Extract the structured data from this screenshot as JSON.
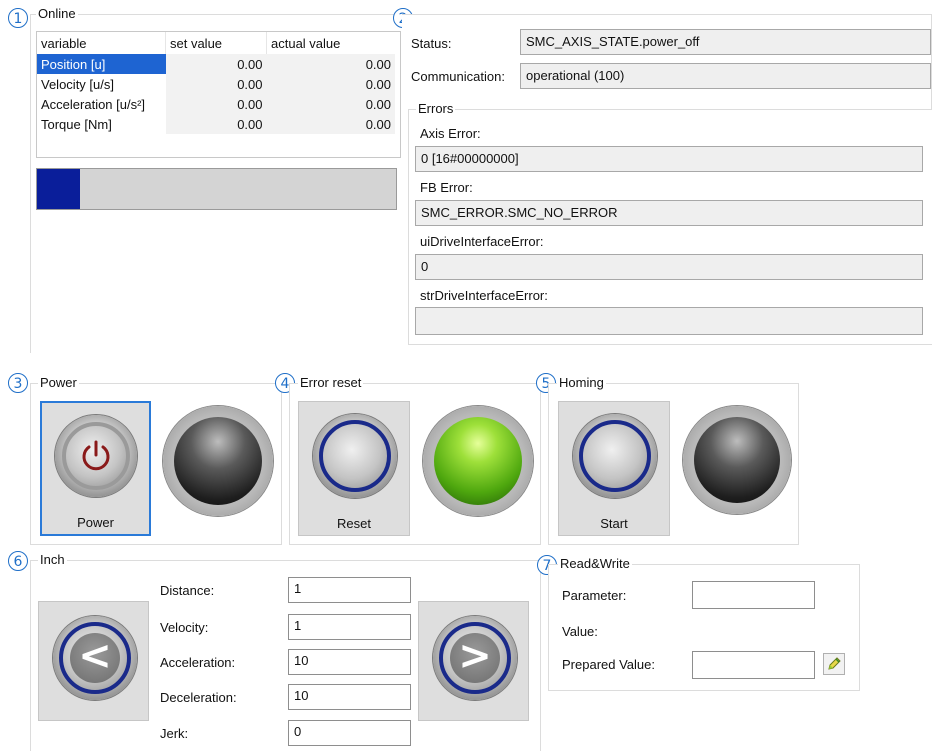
{
  "sections": {
    "online": {
      "num": "1",
      "title": "Online"
    },
    "status": {
      "num": "2"
    },
    "power": {
      "num": "3",
      "title": "Power",
      "button_label": "Power"
    },
    "error_reset": {
      "num": "4",
      "title": "Error reset",
      "button_label": "Reset"
    },
    "homing": {
      "num": "5",
      "title": "Homing",
      "button_label": "Start"
    },
    "inch": {
      "num": "6",
      "title": "Inch"
    },
    "readwrite": {
      "num": "7",
      "title": "Read&Write"
    }
  },
  "online_table": {
    "headers": [
      "variable",
      "set value",
      "actual value"
    ],
    "rows": [
      {
        "variable": "Position [u]",
        "set": "0.00",
        "actual": "0.00"
      },
      {
        "variable": "Velocity [u/s]",
        "set": "0.00",
        "actual": "0.00"
      },
      {
        "variable": "Acceleration [u/s²]",
        "set": "0.00",
        "actual": "0.00"
      },
      {
        "variable": "Torque [Nm]",
        "set": "0.00",
        "actual": "0.00"
      }
    ],
    "selected_row": 0,
    "progress_fraction": 0.12
  },
  "status": {
    "status_label": "Status:",
    "status_value": "SMC_AXIS_STATE.power_off",
    "comm_label": "Communication:",
    "comm_value": "operational (100)",
    "errors_title": "Errors",
    "axis_error_label": "Axis Error:",
    "axis_error_value": "0 [16#00000000]",
    "fb_error_label": "FB Error:",
    "fb_error_value": "SMC_ERROR.SMC_NO_ERROR",
    "ui_drive_label": "uiDriveInterfaceError:",
    "ui_drive_value": "0",
    "str_drive_label": "strDriveInterfaceError:",
    "str_drive_value": ""
  },
  "lamps": {
    "power": "off",
    "error_reset": "green",
    "homing": "off"
  },
  "inch": {
    "distance_label": "Distance:",
    "distance_value": "1",
    "velocity_label": "Velocity:",
    "velocity_value": "1",
    "acceleration_label": "Acceleration:",
    "acceleration_value": "10",
    "deceleration_label": "Deceleration:",
    "deceleration_value": "10",
    "jerk_label": "Jerk:",
    "jerk_value": "0",
    "left_glyph": "<",
    "right_glyph": ">"
  },
  "readwrite": {
    "parameter_label": "Parameter:",
    "parameter_value": "",
    "value_label": "Value:",
    "prepared_label": "Prepared Value:",
    "prepared_value": ""
  },
  "icons": {
    "power": "power-icon",
    "write": "pencil-icon"
  },
  "colors": {
    "selected_row": "#1e64d2",
    "progress": "#0a1e9a",
    "lamp_on": "#6ec81e",
    "ring": "#1a2a8a",
    "power_symbol": "#8a1a1a"
  }
}
